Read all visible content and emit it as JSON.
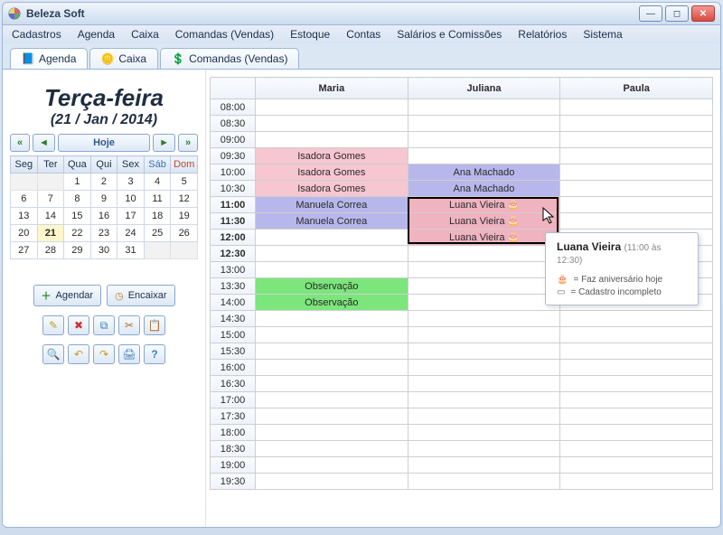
{
  "window": {
    "title": "Beleza Soft"
  },
  "menu": [
    "Cadastros",
    "Agenda",
    "Caixa",
    "Comandas (Vendas)",
    "Estoque",
    "Contas",
    "Salários e Comissões",
    "Relatórios",
    "Sistema"
  ],
  "tabs": [
    {
      "label": "Agenda",
      "active": true,
      "icon": "book"
    },
    {
      "label": "Caixa",
      "active": false,
      "icon": "coins"
    },
    {
      "label": "Comandas (Vendas)",
      "active": false,
      "icon": "money"
    }
  ],
  "sidebar": {
    "day_name": "Terça-feira",
    "date_text": "(21 / Jan / 2014)",
    "today_label": "Hoje",
    "weekdays": [
      "Seg",
      "Ter",
      "Qua",
      "Qui",
      "Sex",
      "Sáb",
      "Dom"
    ],
    "cal_rows": [
      [
        [
          "",
          1
        ],
        [
          "",
          1
        ],
        [
          "1",
          0
        ],
        [
          "2",
          0
        ],
        [
          "3",
          0
        ],
        [
          "4",
          0
        ],
        [
          "5",
          0
        ]
      ],
      [
        [
          "6",
          0
        ],
        [
          "7",
          0
        ],
        [
          "8",
          0
        ],
        [
          "9",
          0
        ],
        [
          "10",
          0
        ],
        [
          "11",
          0
        ],
        [
          "12",
          0
        ]
      ],
      [
        [
          "13",
          0
        ],
        [
          "14",
          0
        ],
        [
          "15",
          0
        ],
        [
          "16",
          0
        ],
        [
          "17",
          0
        ],
        [
          "18",
          0
        ],
        [
          "19",
          0
        ]
      ],
      [
        [
          "20",
          0
        ],
        [
          "21",
          2
        ],
        [
          "22",
          0
        ],
        [
          "23",
          0
        ],
        [
          "24",
          0
        ],
        [
          "25",
          0
        ],
        [
          "26",
          0
        ]
      ],
      [
        [
          "27",
          0
        ],
        [
          "28",
          0
        ],
        [
          "29",
          0
        ],
        [
          "30",
          0
        ],
        [
          "31",
          0
        ],
        [
          "",
          1
        ],
        [
          "",
          1
        ]
      ]
    ],
    "btn_agendar": "Agendar",
    "btn_encaixar": "Encaixar"
  },
  "grid": {
    "columns": [
      "Maria",
      "Juliana",
      "Paula"
    ],
    "times": [
      "08:00",
      "08:30",
      "09:00",
      "09:30",
      "10:00",
      "10:30",
      "11:00",
      "11:30",
      "12:00",
      "12:30",
      "13:00",
      "13:30",
      "14:00",
      "14:30",
      "15:00",
      "15:30",
      "16:00",
      "16:30",
      "17:00",
      "17:30",
      "18:00",
      "18:30",
      "19:00",
      "19:30"
    ],
    "bold_times": [
      "11:00",
      "11:30",
      "12:00",
      "12:30"
    ],
    "appointments": {
      "09:30": [
        {
          "t": "Isadora Gomes",
          "c": "pink"
        },
        null,
        null
      ],
      "10:00": [
        {
          "t": "Isadora Gomes",
          "c": "pink"
        },
        {
          "t": "Ana Machado",
          "c": "violet"
        },
        null
      ],
      "10:30": [
        {
          "t": "Isadora Gomes",
          "c": "pink"
        },
        {
          "t": "Ana Machado",
          "c": "violet"
        },
        null
      ],
      "11:00": [
        {
          "t": "Manuela Correa",
          "c": "violet"
        },
        {
          "t": "Luana Vieira",
          "c": "pink2",
          "cake": true
        },
        null
      ],
      "11:30": [
        {
          "t": "Manuela Correa",
          "c": "violet"
        },
        {
          "t": "Luana Vieira",
          "c": "pink2",
          "cake": true
        },
        null
      ],
      "12:00": [
        null,
        {
          "t": "Luana Vieira",
          "c": "pink2",
          "cake": true
        },
        null
      ],
      "13:30": [
        {
          "t": "Observação",
          "c": "green"
        },
        null,
        null
      ],
      "14:00": [
        {
          "t": "Observação",
          "c": "green"
        },
        null,
        null
      ]
    }
  },
  "tooltip": {
    "name": "Luana Vieira",
    "time": "(11:00 às 12:30)",
    "row1": "= Faz aniversário hoje",
    "row2": "= Cadastro incompleto"
  }
}
